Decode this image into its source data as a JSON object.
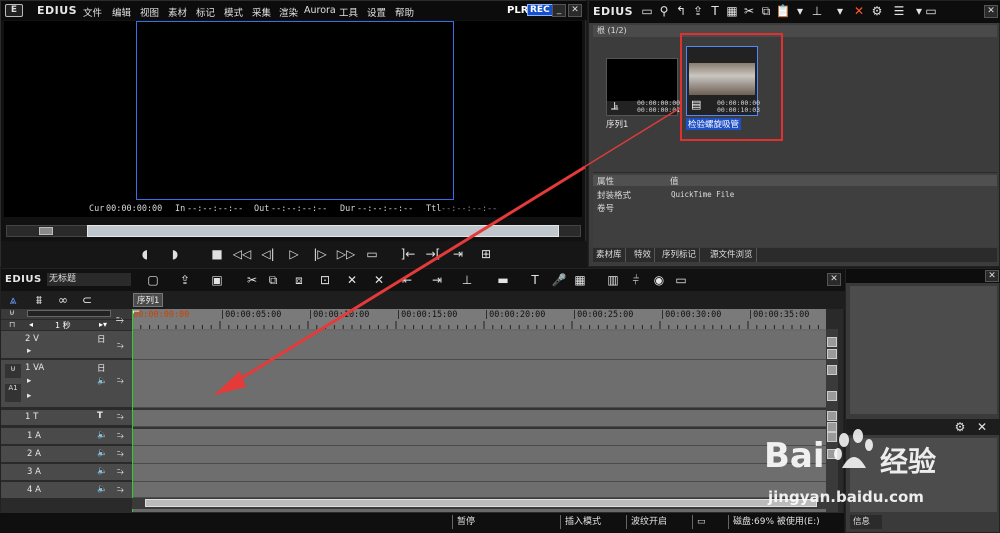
{
  "preview": {
    "logo": "E",
    "app_name": "EDIUS",
    "menu": [
      "文件",
      "编辑",
      "视图",
      "素材",
      "标记",
      "模式",
      "采集",
      "渲染",
      "Aurora",
      "工具",
      "设置",
      "帮助"
    ],
    "plr": "PLR",
    "rec": "REC",
    "timecodes": {
      "cur_label": "Cur",
      "cur_value": "00:00:00:00",
      "in_label": "In",
      "in_value": "--:--:--:--",
      "out_label": "Out",
      "out_value": "--:--:--:--",
      "dur_label": "Dur",
      "dur_value": "--:--:--:--",
      "ttl_label": "Ttl",
      "ttl_value": "--:--:--:--"
    }
  },
  "bin": {
    "app_name": "EDIUS",
    "path": "根 (1/2)",
    "clips": [
      {
        "name": "序列1",
        "tc_in": "00:00:00:00",
        "tc_out": "00:00:00:01",
        "icon": "seq-icon"
      },
      {
        "name": "检验螺旋吸管",
        "tc_in": "00:00:00:00",
        "tc_out": "00:00:10:03",
        "icon": "clip-icon"
      }
    ],
    "props_header": {
      "col1": "属性",
      "col2": "值"
    },
    "props": [
      {
        "key": "封装格式",
        "value": "QuickTime File"
      },
      {
        "key": "卷号",
        "value": ""
      }
    ],
    "tabs": [
      "素材库",
      "特效",
      "序列标记",
      "源文件浏览"
    ]
  },
  "timeline": {
    "app_name": "EDIUS",
    "project_name": "无标题",
    "sequence_tab": "序列1",
    "scale_label": "1 秒",
    "ruler_ticks": [
      "00:00:00:00",
      "|00:00:05:00",
      "|00:00:10:00",
      "|00:00:15:00",
      "|00:00:20:00",
      "|00:00:25:00",
      "|00:00:30:00",
      "|00:00:35:00"
    ],
    "tracks": [
      {
        "label": "2 V"
      },
      {
        "label": "1 VA"
      },
      {
        "label": "1 T"
      },
      {
        "label": "1 A"
      },
      {
        "label": "2 A"
      },
      {
        "label": "3 A"
      },
      {
        "label": "4 A"
      }
    ]
  },
  "statusbar": {
    "state": "暂停",
    "mode": "插入模式",
    "ripple": "波纹开启",
    "disk": "磁盘:69% 被使用(E:)"
  },
  "info_panel": {
    "tab": "信息"
  },
  "watermark": {
    "brand": "Bai",
    "brand_cn": "经验",
    "url": "jingyan.baidu.com"
  },
  "colors": {
    "accent_blue": "#1650c8",
    "annotation_red": "#e03030",
    "cursor_green": "#2bd02b",
    "current_time": "#d04000"
  }
}
